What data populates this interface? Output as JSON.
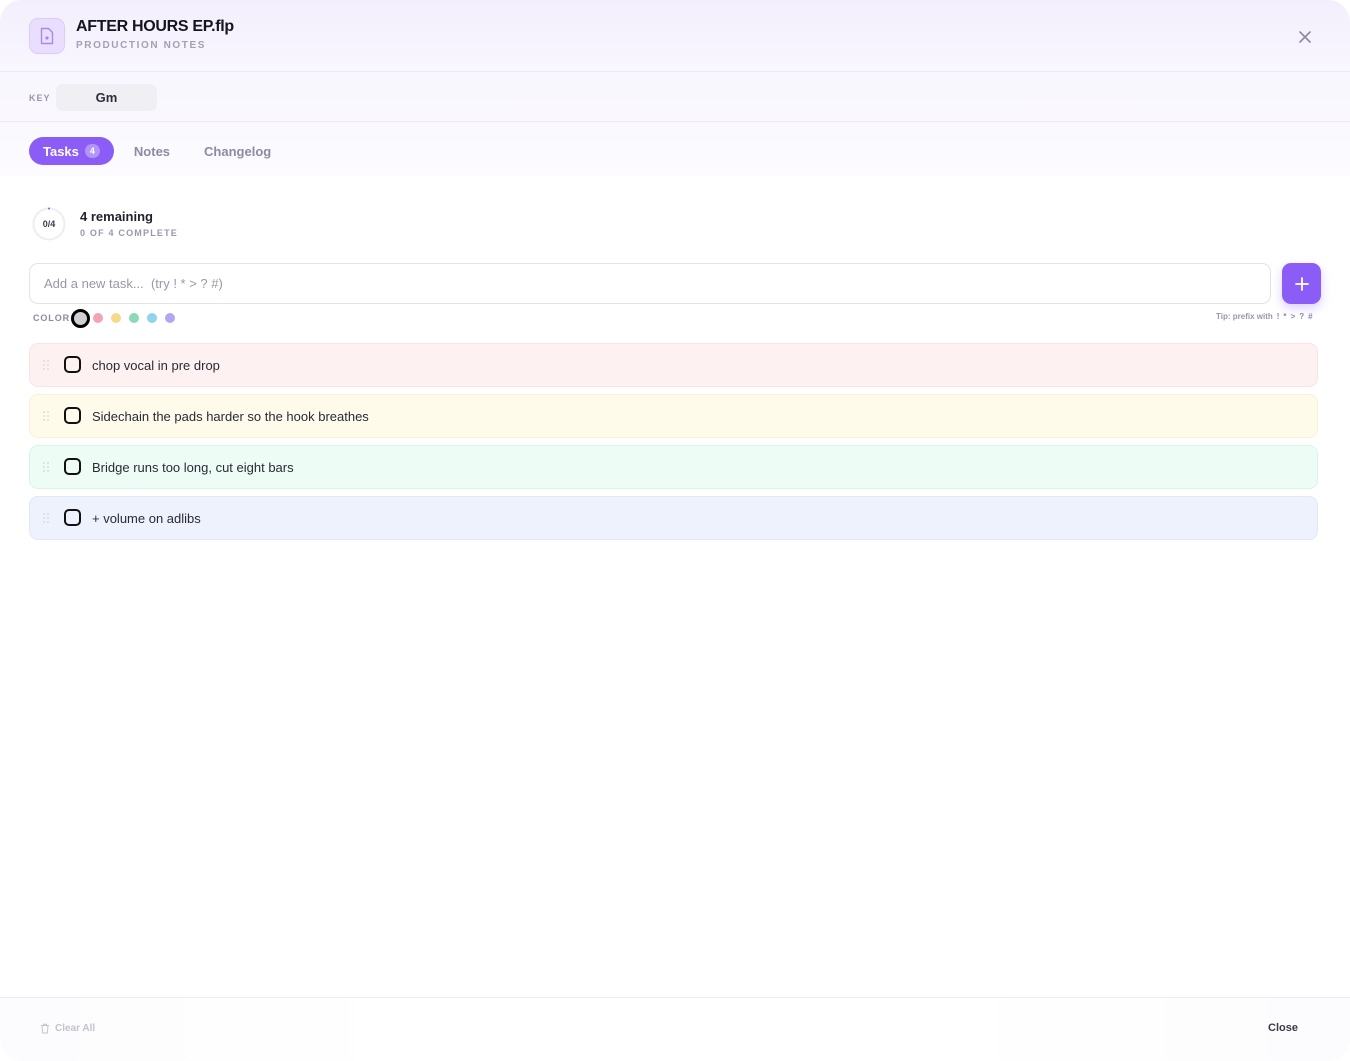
{
  "header": {
    "title": "AFTER HOURS EP.flp",
    "subtitle": "PRODUCTION NOTES",
    "file_icon": "file-icon",
    "close_icon": "close-icon"
  },
  "key": {
    "label": "KEY",
    "value": "Gm"
  },
  "tabs": [
    {
      "label": "Tasks",
      "count": "4",
      "active": true
    },
    {
      "label": "Notes",
      "active": false
    },
    {
      "label": "Changelog",
      "active": false
    }
  ],
  "progress": {
    "ring_text": "0/4",
    "done_fraction": 0,
    "remaining": "4 remaining",
    "complete": "0 OF 4 COMPLETE"
  },
  "input": {
    "placeholder": "Add a new task...  (try ! * > ? #)",
    "value": "",
    "add_icon": "plus-icon"
  },
  "colors": {
    "label": "COLOR",
    "swatches": [
      "#cfcfd4",
      "#f4a3b5",
      "#f8d98a",
      "#8ad9b7",
      "#8fd3ee",
      "#b0a8f4"
    ],
    "selected": 0
  },
  "tip": {
    "text": "Tip: prefix with",
    "symbols": [
      "!",
      "*",
      ">",
      "?",
      "#"
    ]
  },
  "tasks": [
    {
      "text": "chop vocal in pre drop",
      "bg": "#fef1f1",
      "border": "#fbe3e3",
      "checked": false
    },
    {
      "text": "Sidechain the pads harder so the hook breathes",
      "bg": "#fefbeb",
      "border": "#fbf1cf",
      "checked": false
    },
    {
      "text": "Bridge runs too long, cut eight bars",
      "bg": "#edfdf5",
      "border": "#d6f5e6",
      "checked": false
    },
    {
      "text": "+ volume on adlibs",
      "bg": "#eef2fd",
      "border": "#e2e8fa",
      "checked": false
    }
  ],
  "footer": {
    "clear_all": "Clear All",
    "close": "Close"
  },
  "accent": "#8b5cf6"
}
